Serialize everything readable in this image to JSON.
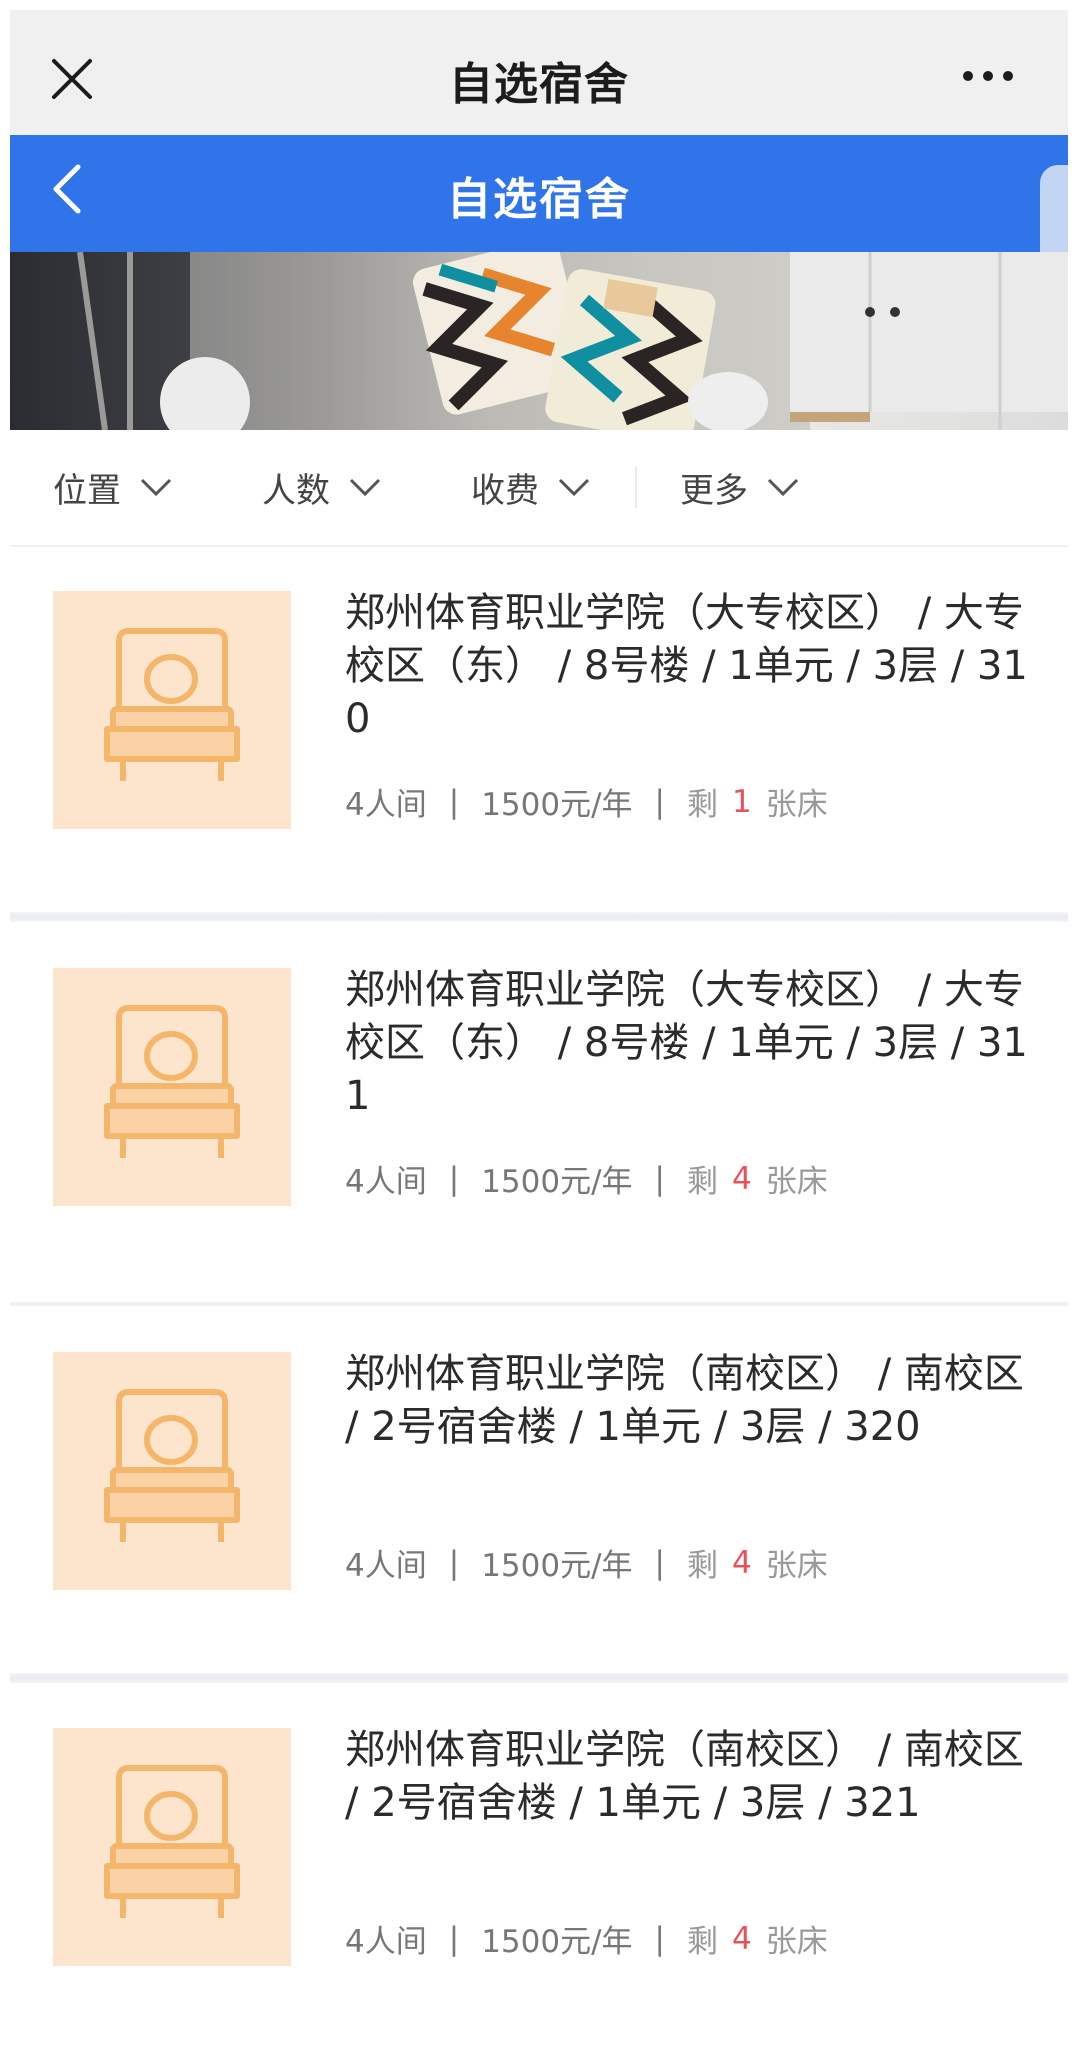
{
  "webview": {
    "title": "自选宿舍"
  },
  "header": {
    "title": "自选宿舍"
  },
  "filters": [
    {
      "label": "位置"
    },
    {
      "label": "人数"
    },
    {
      "label": "收费"
    },
    {
      "label": "更多"
    }
  ],
  "rooms": [
    {
      "title": "郑州体育职业学院（大专校区） / 大专校区（东） / 8号楼 / 1单元 / 3层 / 310",
      "capacity": "4人间",
      "price": "1500元/年",
      "remain_prefix": "剩",
      "remain_count": "1",
      "remain_suffix": "张床"
    },
    {
      "title": "郑州体育职业学院（大专校区） / 大专校区（东） / 8号楼 / 1单元 / 3层 / 311",
      "capacity": "4人间",
      "price": "1500元/年",
      "remain_prefix": "剩",
      "remain_count": "4",
      "remain_suffix": "张床"
    },
    {
      "title": "郑州体育职业学院（南校区） / 南校区 / 2号宿舍楼 / 1单元 / 3层 / 320",
      "capacity": "4人间",
      "price": "1500元/年",
      "remain_prefix": "剩",
      "remain_count": "4",
      "remain_suffix": "张床"
    },
    {
      "title": "郑州体育职业学院（南校区） / 南校区 / 2号宿舍楼 / 1单元 / 3层 / 321",
      "capacity": "4人间",
      "price": "1500元/年",
      "remain_prefix": "剩",
      "remain_count": "4",
      "remain_suffix": "张床"
    }
  ],
  "separator": "|",
  "colors": {
    "header_blue": "#2f74e8",
    "remain_red": "#e8525b",
    "thumb_bg": "#fde4cc",
    "bed_icon": "#f4b66a"
  },
  "icons": {
    "close": "close-icon",
    "more": "more-icon",
    "back": "back-icon",
    "chevron": "chevron-down-icon",
    "bed": "bed-icon"
  }
}
